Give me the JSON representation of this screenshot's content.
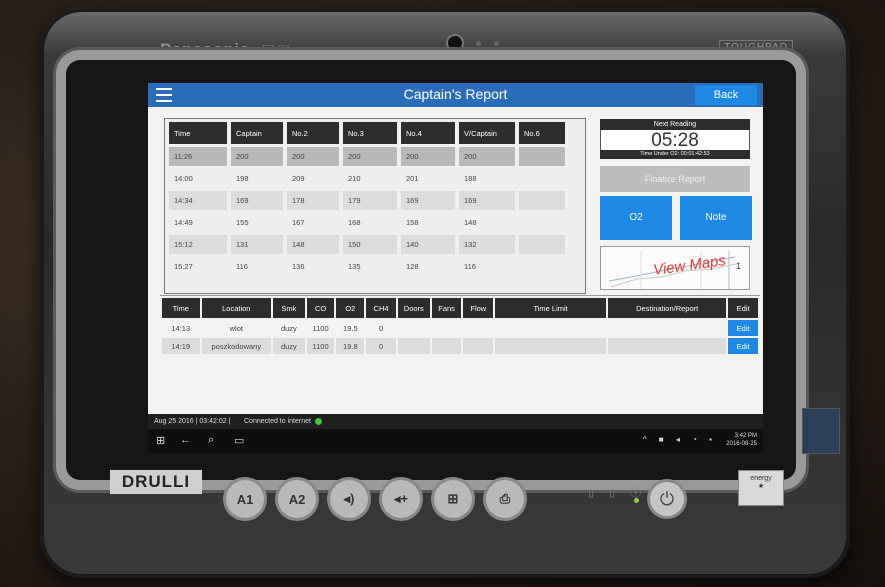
{
  "device": {
    "brand": "Panasonic",
    "model": "FZ-G1",
    "series": "TOUGHPAD",
    "sticker": "DRULLI",
    "hw_buttons": [
      "A1",
      "A2",
      "◂)",
      "◂+",
      "⊞",
      "⎙"
    ]
  },
  "header": {
    "title": "Captain's Report",
    "back_label": "Back"
  },
  "readings": {
    "columns": [
      "Time",
      "Captain",
      "No.2",
      "No.3",
      "No.4",
      "V/Captain",
      "No.6"
    ],
    "rows": [
      [
        "11:26",
        "200",
        "200",
        "200",
        "200",
        "200",
        ""
      ],
      [
        "14:00",
        "198",
        "209",
        "210",
        "201",
        "188",
        ""
      ],
      [
        "14:34",
        "169",
        "178",
        "179",
        "169",
        "169",
        ""
      ],
      [
        "14:49",
        "155",
        "167",
        "168",
        "158",
        "148",
        ""
      ],
      [
        "15:12",
        "131",
        "148",
        "150",
        "140",
        "132",
        ""
      ],
      [
        "15:27",
        "116",
        "136",
        "135",
        "128",
        "116",
        ""
      ]
    ]
  },
  "panel": {
    "next_reading_label": "Next Reading",
    "next_reading_time": "05:28",
    "time_under_o2": "Time Under O2: 00:01:42:53",
    "finalize_label": "Finalize Report",
    "o2_label": "O2",
    "note_label": "Note",
    "view_maps_label": "View Maps",
    "maps_page": "1"
  },
  "locations": {
    "columns": [
      "Time",
      "Location",
      "Smk",
      "CO",
      "O2",
      "CH4",
      "Doors",
      "Fans",
      "Flow",
      "Time Limit",
      "Destination/Report",
      "Edit"
    ],
    "rows": [
      [
        "14:13",
        "wlot",
        "duzy",
        "1100",
        "19.5",
        "0",
        "",
        "",
        "",
        "",
        "",
        "Edit"
      ],
      [
        "14:19",
        "poszkodowany",
        "duzy",
        "1100",
        "19.8",
        "0",
        "",
        "",
        "",
        "",
        "",
        "Edit"
      ]
    ]
  },
  "status": {
    "datetime": "Aug 25 2016 | 03:42:02 |",
    "connection": "Connected to internet"
  },
  "taskbar": {
    "clock_time": "3:42 PM",
    "clock_date": "2016-08-25"
  },
  "colors": {
    "accent": "#1e88e5",
    "titlebar": "#2b6cb8",
    "header_cell": "#2d2d2d",
    "connected": "#3fc53f",
    "maps_label": "#e53935"
  }
}
